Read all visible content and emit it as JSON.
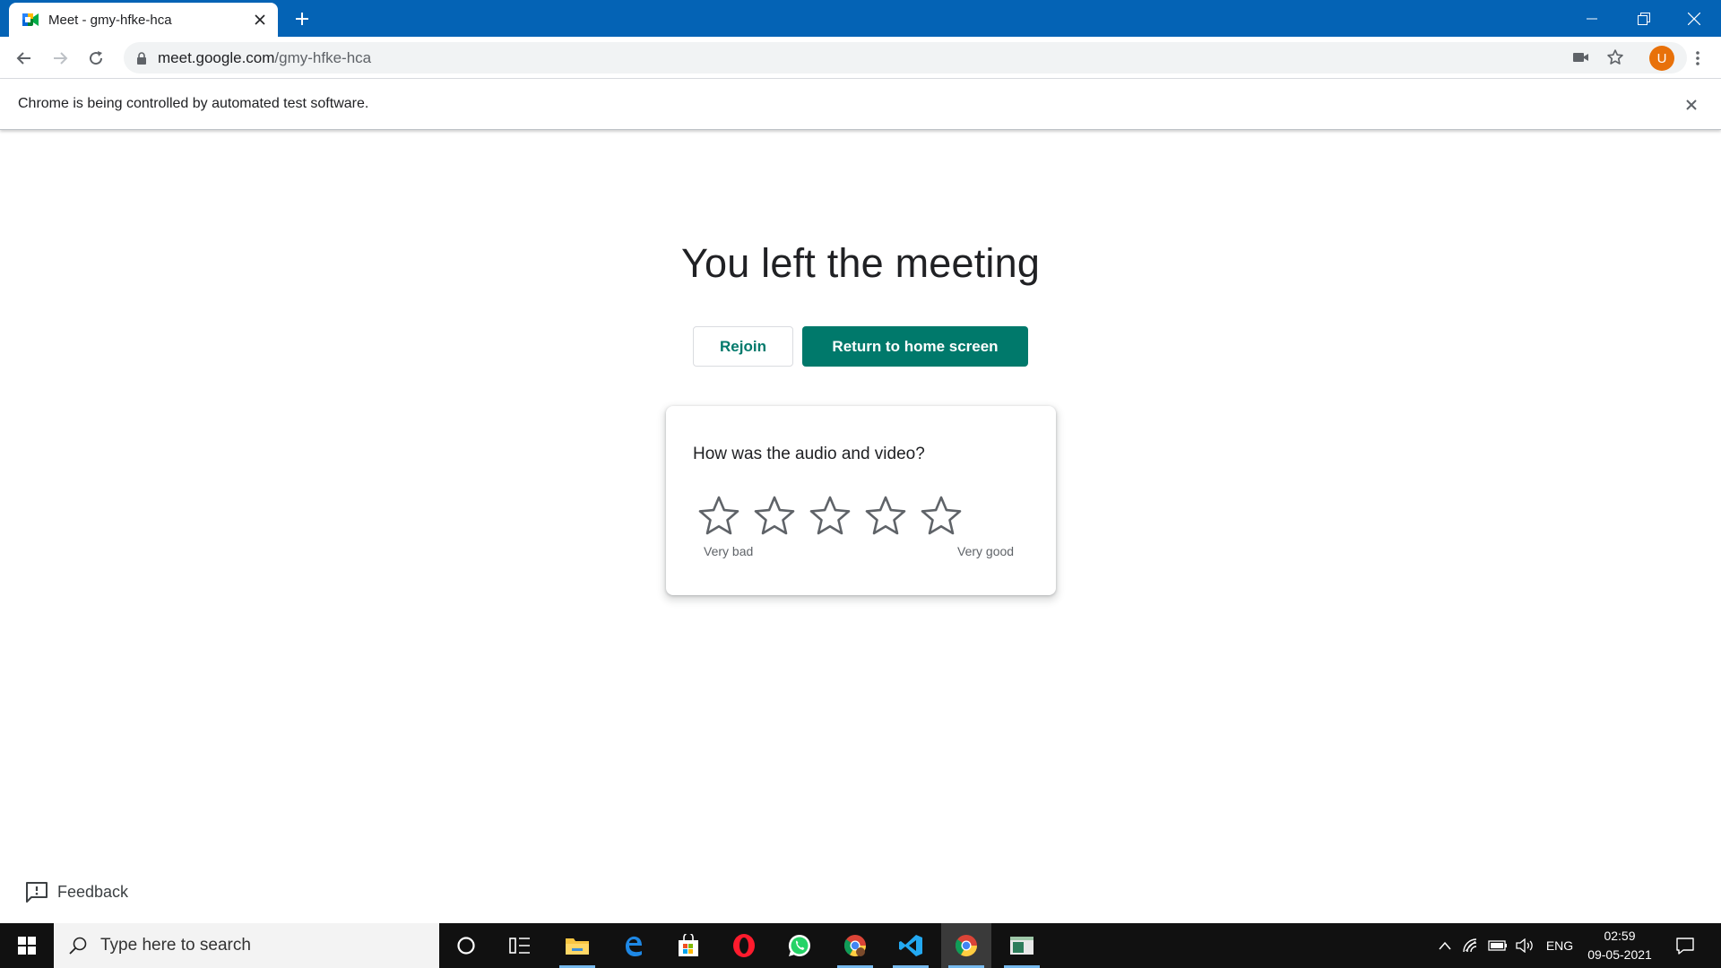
{
  "browser": {
    "tab_title": "Meet - gmy-hfke-hca",
    "url_host": "meet.google.com",
    "url_path": "/gmy-hfke-hca",
    "avatar_letter": "U",
    "infobar_text": "Chrome is being controlled by automated test software."
  },
  "page": {
    "heading": "You left the meeting",
    "rejoin_label": "Rejoin",
    "home_label": "Return to home screen",
    "rating": {
      "question": "How was the audio and video?",
      "star_count": 5,
      "selected": 0,
      "low_label": "Very bad",
      "high_label": "Very good"
    },
    "feedback_label": "Feedback"
  },
  "taskbar": {
    "search_placeholder": "Type here to search",
    "language": "ENG",
    "time": "02:59",
    "date": "09-05-2021",
    "apps": [
      "cortana-icon",
      "task-view-icon",
      "file-explorer-icon",
      "edge-icon",
      "microsoft-store-icon",
      "opera-icon",
      "whatsapp-icon",
      "chrome-profile-icon",
      "vscode-icon",
      "chrome-icon",
      "notepad-app-icon"
    ]
  },
  "colors": {
    "titlebar": "#0463b5",
    "meet_green": "#00796b",
    "avatar": "#e8710a",
    "taskbar": "#111111"
  }
}
